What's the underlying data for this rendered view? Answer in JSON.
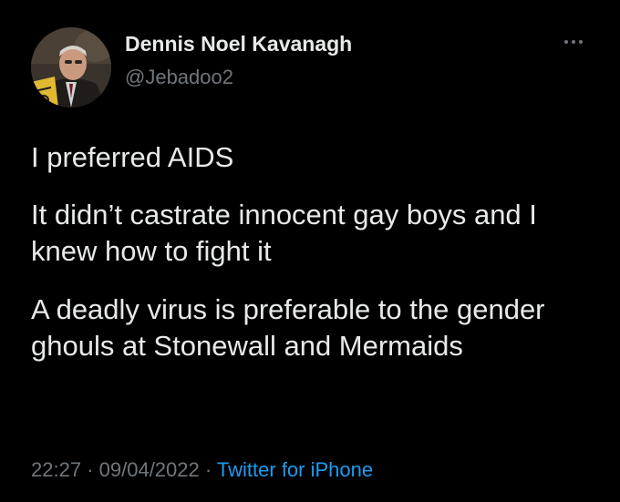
{
  "author": {
    "display_name": "Dennis Noel Kavanagh",
    "handle": "@Jebadoo2"
  },
  "tweet": {
    "paragraphs": [
      "I preferred AIDS",
      "It didn’t castrate innocent gay boys and I knew how to fight it",
      "A deadly virus is preferable to the gender ghouls at Stonewall and Mermaids"
    ],
    "time": "22:27",
    "date": "09/04/2022",
    "source": "Twitter for iPhone",
    "separator": "·"
  },
  "icons": {
    "more": "more-horizontal-icon"
  },
  "colors": {
    "background": "#000000",
    "primary_text": "#e7e9ea",
    "secondary_text": "#71767b",
    "link": "#1d9bf0"
  }
}
